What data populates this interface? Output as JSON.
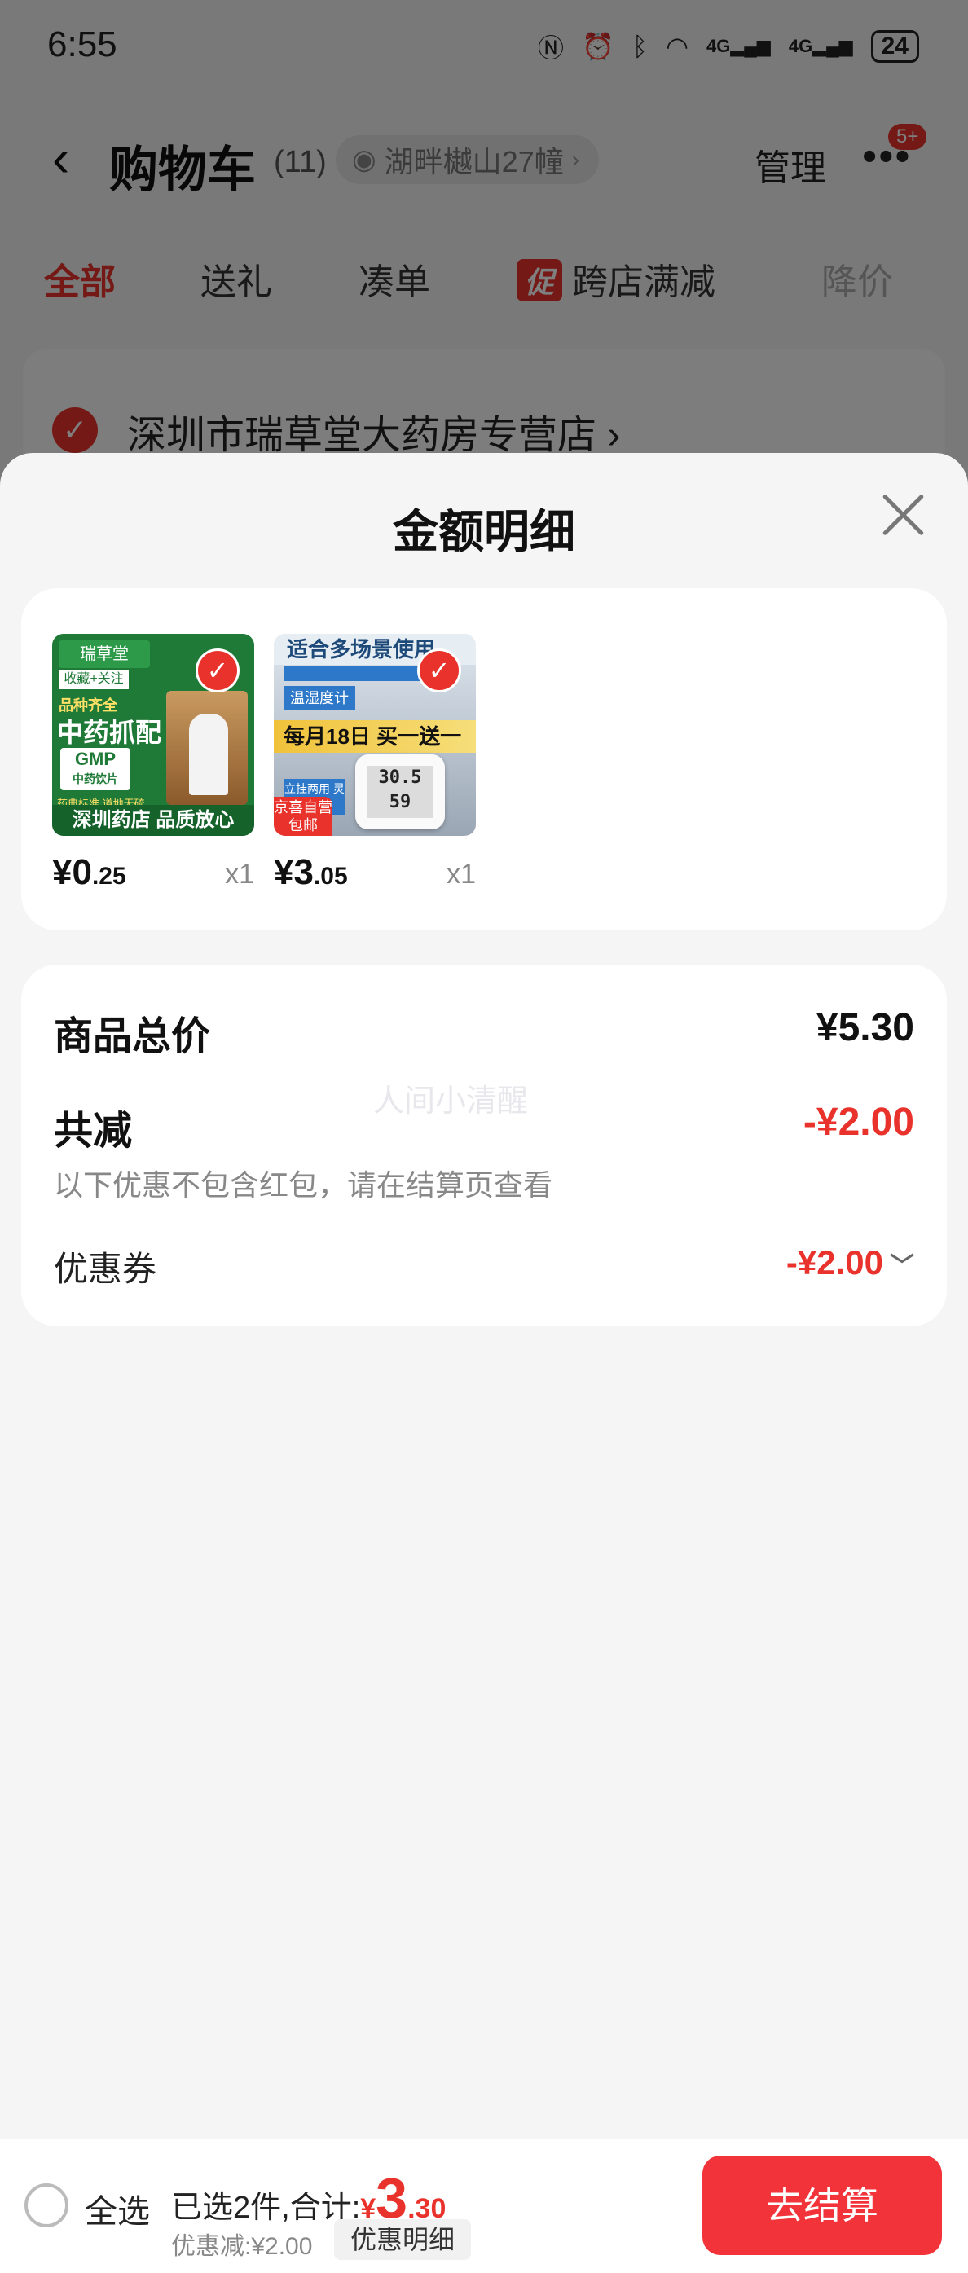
{
  "status_bar": {
    "time": "6:55",
    "net1": "4G",
    "net2": "4G",
    "battery": "24"
  },
  "nav": {
    "title": "购物车",
    "count": "(11)",
    "address": "湖畔樾山27幢",
    "manage": "管理",
    "more_badge": "5+"
  },
  "tabs": [
    {
      "label": "全部",
      "active": true
    },
    {
      "label": "送礼"
    },
    {
      "label": "凑单"
    },
    {
      "label": "跨店满减",
      "badge": "促"
    },
    {
      "label": "降价"
    }
  ],
  "store": {
    "name": "深圳市瑞草堂大药房专营店"
  },
  "sheet": {
    "title": "金额明细",
    "products": [
      {
        "price_currency": "¥",
        "price_int": "0",
        "price_dec": ".25",
        "qty": "x1",
        "image_texts": {
          "logo": "瑞草堂",
          "follow": "收藏+关注",
          "line1": "品种齐全",
          "line2": "中药抓配",
          "gmp": "GMP",
          "gmp_sub": "中药饮片",
          "line3": "药典标准 道地无硫",
          "band": "深圳药店 品质放心"
        }
      },
      {
        "price_currency": "¥",
        "price_int": "3",
        "price_dec": ".05",
        "qty": "x1",
        "image_texts": {
          "top": "适合多场景使用",
          "tag1": "温湿度计",
          "promo": "每月18日 买一送一",
          "screen_temp": "30.5",
          "screen_hum": "59",
          "tag2": "立挂两用 灵活摆放",
          "ship": "京喜自营 包邮"
        }
      }
    ],
    "summary": {
      "total_label": "商品总价",
      "total_value": "¥5.30",
      "discount_label": "共减",
      "discount_value": "-¥2.00",
      "note": "以下优惠不包含红包，请在结算页查看",
      "coupon_label": "优惠券",
      "coupon_value": "-¥2.00",
      "watermark": "人间小清醒"
    }
  },
  "bottom_bar": {
    "select_all": "全选",
    "selected_prefix": "已选2件,合计:",
    "total_currency": "¥",
    "total_int": "3",
    "total_dec": ".30",
    "discount_note": "优惠减:¥2.00",
    "detail_chip": "优惠明细",
    "checkout": "去结算"
  },
  "colors": {
    "accent": "#e8322b",
    "checkout_button": "#f2343a",
    "background": "#f5f5f5"
  }
}
